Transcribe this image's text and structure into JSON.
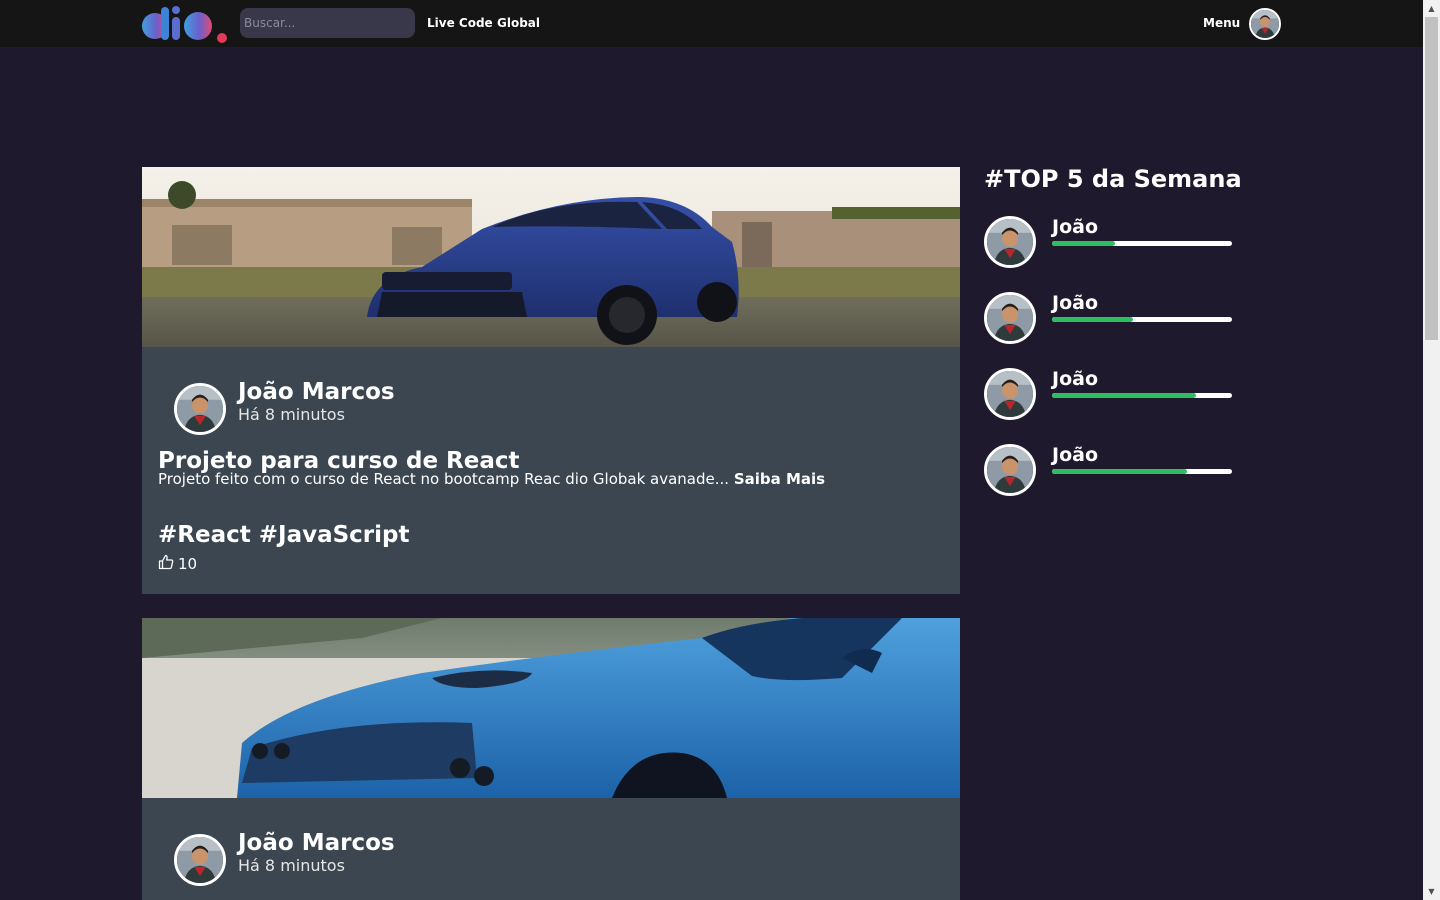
{
  "header": {
    "search_placeholder": "Buscar...",
    "nav_links": [
      "Live Code",
      "Global"
    ],
    "menu_label": "Menu"
  },
  "feed": [
    {
      "author": "João Marcos",
      "time": "Há 8 minutos",
      "title": "Projeto para curso de React",
      "description": "Projeto feito com o curso de React no bootcamp Reac dio Globak avanade...",
      "read_more": "Saiba Mais",
      "tags": "#React #JavaScript",
      "likes": "10"
    },
    {
      "author": "João Marcos",
      "time": "Há 8 minutos"
    }
  ],
  "ranking": {
    "title": "#TOP 5 da Semana",
    "items": [
      {
        "name": "João",
        "progress": 0.35
      },
      {
        "name": "João",
        "progress": 0.45
      },
      {
        "name": "João",
        "progress": 0.8
      },
      {
        "name": "João",
        "progress": 0.75
      }
    ]
  },
  "colors": {
    "background": "#1e192c",
    "header": "#151515",
    "card": "#3b4651",
    "progress_fill": "#2fbd62",
    "progress_track": "#ffffff"
  },
  "icons": [
    "dio-logo",
    "avatar-photo",
    "thumbs-up-icon"
  ]
}
